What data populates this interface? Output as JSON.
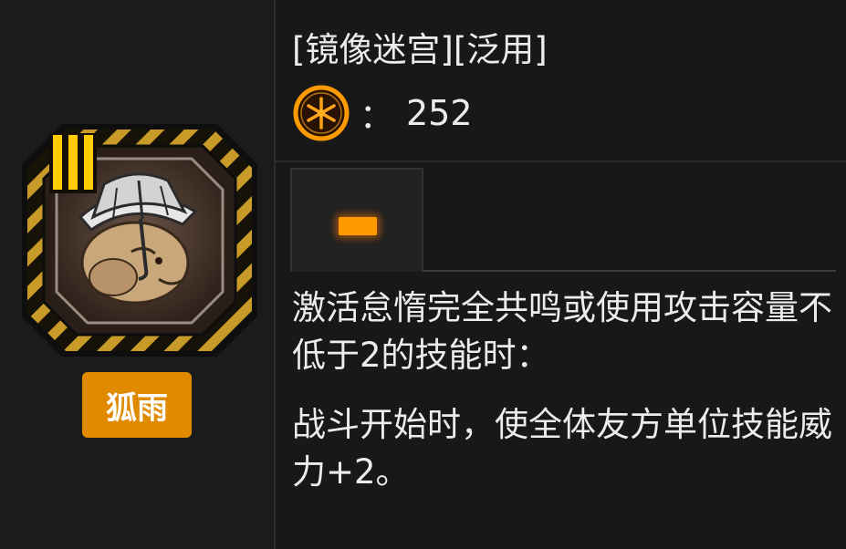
{
  "gift": {
    "name": "狐雨",
    "tier_numeral": "III",
    "icon": "straw-hat-fox-icon",
    "badge_color": "#e08a00"
  },
  "info": {
    "tags": "[镜像迷宫][泛用]",
    "cost_icon": "cost-coin-icon",
    "cost_separator": "：",
    "cost_value": "252"
  },
  "effect": {
    "tab_icon": "tier-one-bar-icon",
    "condition": "激活怠惰完全共鸣或使用攻击容量不低于2的技能时：",
    "result": "战斗开始时，使全体友方单位技能威力+2。"
  },
  "colors": {
    "accent": "#ff9900",
    "badge": "#e08a00",
    "background": "#1a1a1a"
  }
}
